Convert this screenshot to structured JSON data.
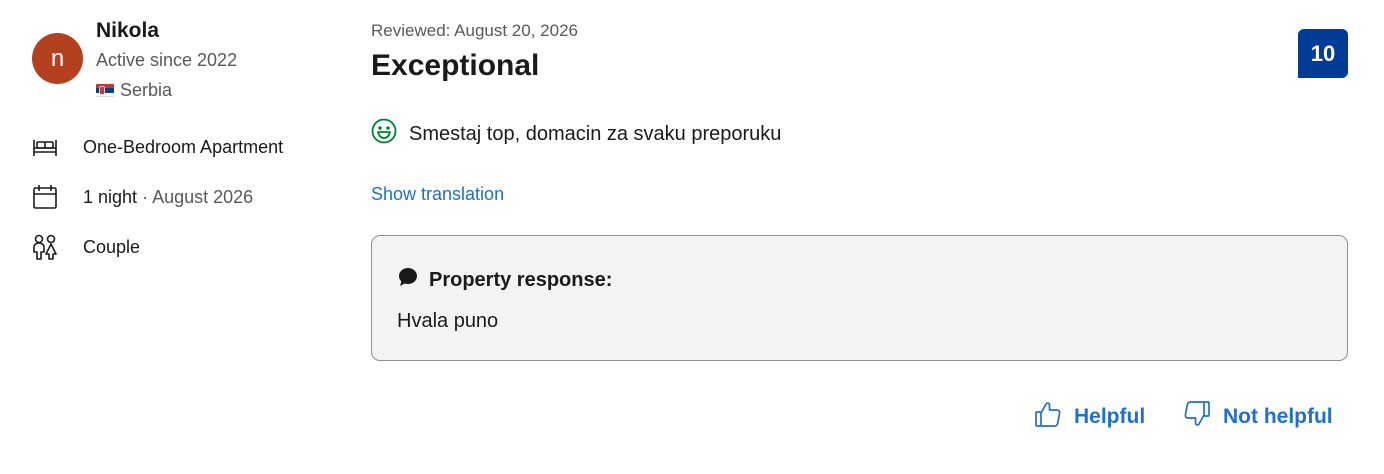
{
  "reviewer": {
    "avatar_initial": "n",
    "name": "Nikola",
    "active_since": "Active since 2022",
    "country": "Serbia",
    "avatar_color": "#b3411f"
  },
  "stay": {
    "room": "One-Bedroom Apartment",
    "nights": "1 night",
    "separator": "·",
    "date": "August 2026",
    "traveler_type": "Couple"
  },
  "review": {
    "reviewed_date": "Reviewed: August 20, 2026",
    "title": "Exceptional",
    "score": "10",
    "positive_text": "Smestaj top, domacin za svaku preporuku",
    "show_translation": "Show translation"
  },
  "property_response": {
    "label": "Property response:",
    "text": "Hvala puno"
  },
  "actions": {
    "helpful": "Helpful",
    "not_helpful": "Not helpful"
  },
  "colors": {
    "score_bg": "#003b95",
    "link": "#1f6fd1",
    "positive_icon": "#008234"
  }
}
